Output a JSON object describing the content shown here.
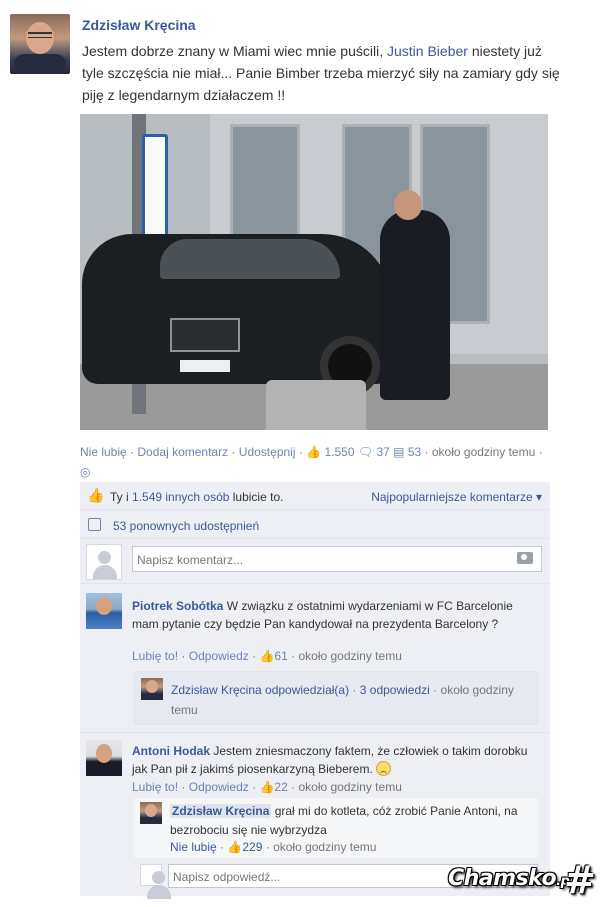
{
  "post": {
    "author": "Zdzisław Kręcina",
    "text_before": "Jestem dobrze znany w Miami wiec mnie puścili, ",
    "mention": "Justin Bieber",
    "text_after": " niestety już tyle szczęścia nie miał... Panie Bimber trzeba mierzyć siły na zamiary gdy się piję z legendarnym działaczem !!"
  },
  "actions": {
    "unlike": "Nie lubię",
    "add_comment": "Dodaj komentarz",
    "share": "Udostępnij",
    "likes_count": "1.550",
    "comments_count": "37",
    "shares_count": "53",
    "time": "około godziny temu",
    "sep": "·"
  },
  "ufi": {
    "likes_prefix": "Ty i ",
    "likes_link": "1.549 innych osób",
    "likes_suffix": " lubicie to.",
    "sort_label": "Najpopularniejsze komentarze",
    "shares_text": "53 ponownych udostępnień",
    "comment_placeholder": "Napisz komentarz..."
  },
  "comments": [
    {
      "author": "Piotrek Sobótka",
      "text": "W związku z ostatnimi wydarzeniami w FC Barcelonie mam pytanie czy będzie Pan kandydował na prezydenta Barcelony ?",
      "like_label": "Lubię to!",
      "reply_label": "Odpowiedz",
      "likes": "61",
      "time": "około godziny temu",
      "replies_summary": {
        "author": "Zdzisław Kręcina odpowiedział(a)",
        "count": "3 odpowiedzi",
        "time": "około godziny temu"
      }
    },
    {
      "author": "Antoni Hodak",
      "text": "Jestem zniesmaczony faktem, że człowiek o takim dorobku jak Pan pił z jakimś piosenkarzyną Bieberem.",
      "like_label": "Lubię to!",
      "reply_label": "Odpowiedz",
      "likes": "22",
      "time": "około godziny temu",
      "reply": {
        "author": "Zdzisław Kręcina",
        "text": " grał mi do kotleta, cóż zrobić Panie Antoni, na bezrobociu się nie wybrzydza",
        "unlike_label": "Nie lubię",
        "likes": "229",
        "time": "około godziny temu"
      },
      "reply_placeholder": "Napisz odpowiedź..."
    }
  ],
  "watermark": {
    "text": "Chamsko",
    "suffix": ".pl",
    "symbol": "#"
  },
  "colors": {
    "link": "#3b5998",
    "ufi_bg": "#edeff4",
    "muted": "#777777"
  }
}
